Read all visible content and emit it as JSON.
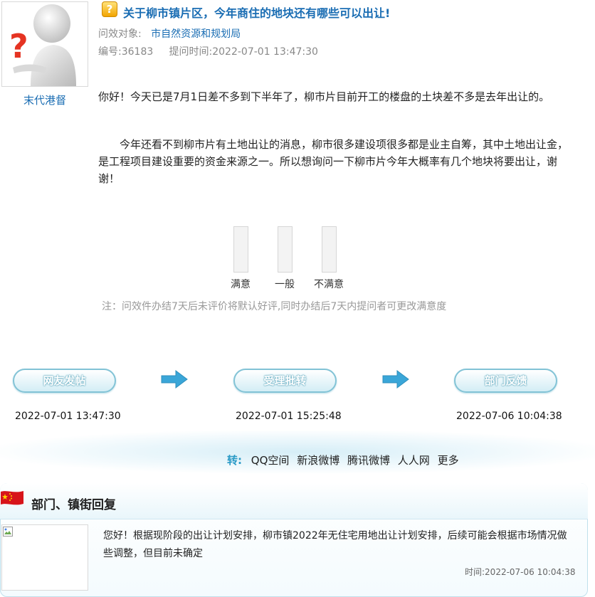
{
  "question": {
    "title": "关于柳市镇片区，今年商住的地块还有哪些可以出让!",
    "target_label": "问效对象:",
    "target_value": "市自然资源和规划局",
    "id_text": "编号:36183",
    "time_text": "提问时间:2022-07-01 13:47:30",
    "username": "末代港督",
    "paragraphs": [
      "你好！今天已是7月1日差不多到下半年了，柳市片目前开工的楼盘的土块差不多是去年出让的。",
      "今年还看不到柳市片有土地出让的消息，柳市很多建设项很多都是业主自筹，其中土地出让金，是工程项目建设重要的资金来源之一。所以想询问一下柳市片今年大概率有几个地块将要出让，谢谢！"
    ]
  },
  "rating": {
    "options": [
      {
        "label": "满意",
        "level": 0
      },
      {
        "label": "一般",
        "level": 0
      },
      {
        "label": "不满意",
        "level": 0
      }
    ],
    "note": "注：问效件办结7天后未评价将默认好评,同时办结后7天内提问者可更改满意度"
  },
  "flow": {
    "steps": [
      {
        "label": "网友发帖",
        "time": "2022-07-01 13:47:30"
      },
      {
        "label": "受理批转",
        "time": "2022-07-01 15:25:48"
      },
      {
        "label": "部门反馈",
        "time": "2022-07-06 10:04:38"
      }
    ],
    "accent": "#3aa6d8"
  },
  "share": {
    "prefix": "转:",
    "links": [
      "QQ空间",
      "新浪微博",
      "腾讯微博",
      "人人网",
      "更多"
    ]
  },
  "reply": {
    "title": "部门、镇街回复",
    "text": "您好！根据现阶段的出让计划安排，柳市镇2022年无住宅用地出让计划安排，后续可能会根据市场情况做些调整，但目前未确定",
    "time": "时间:2022-07-06 10:04:38"
  },
  "colors": {
    "link": "#1a6db3",
    "flag": "#d7141a"
  }
}
